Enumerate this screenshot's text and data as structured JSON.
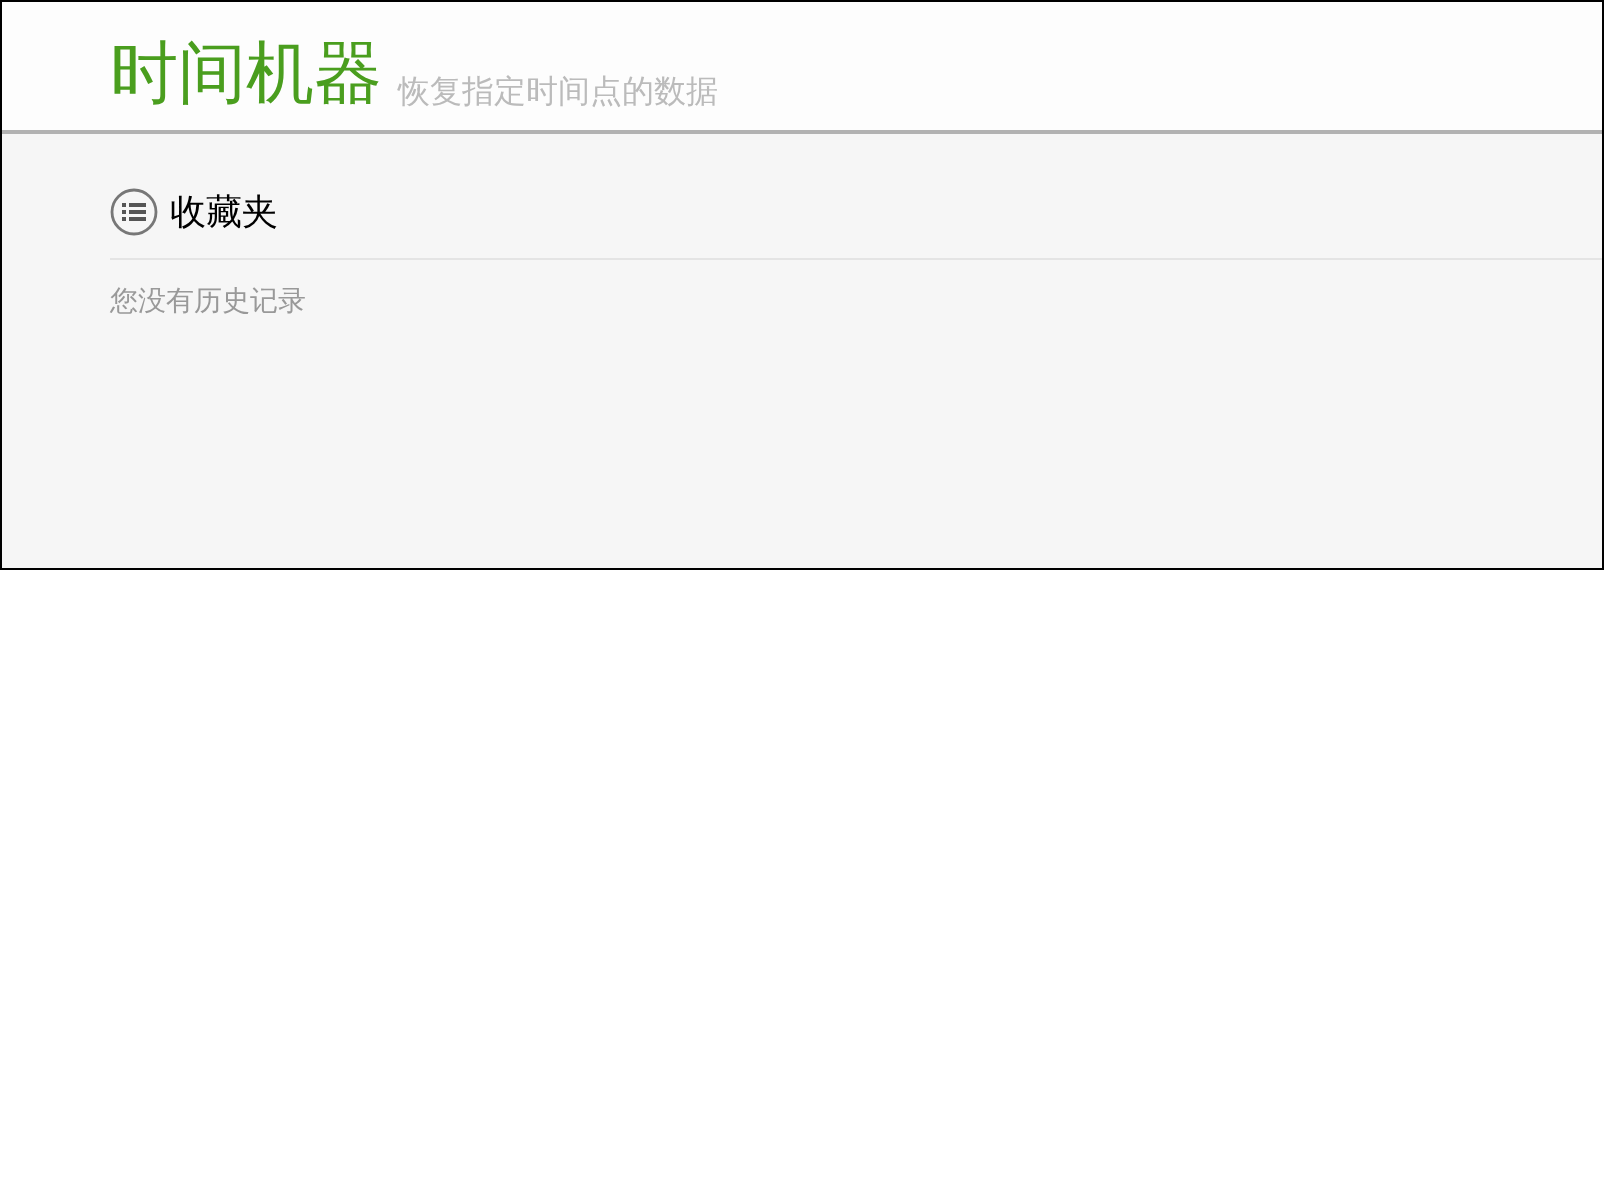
{
  "header": {
    "title": "时间机器",
    "subtitle": "恢复指定时间点的数据"
  },
  "section": {
    "title": "收藏夹",
    "empty_message": "您没有历史记录"
  }
}
